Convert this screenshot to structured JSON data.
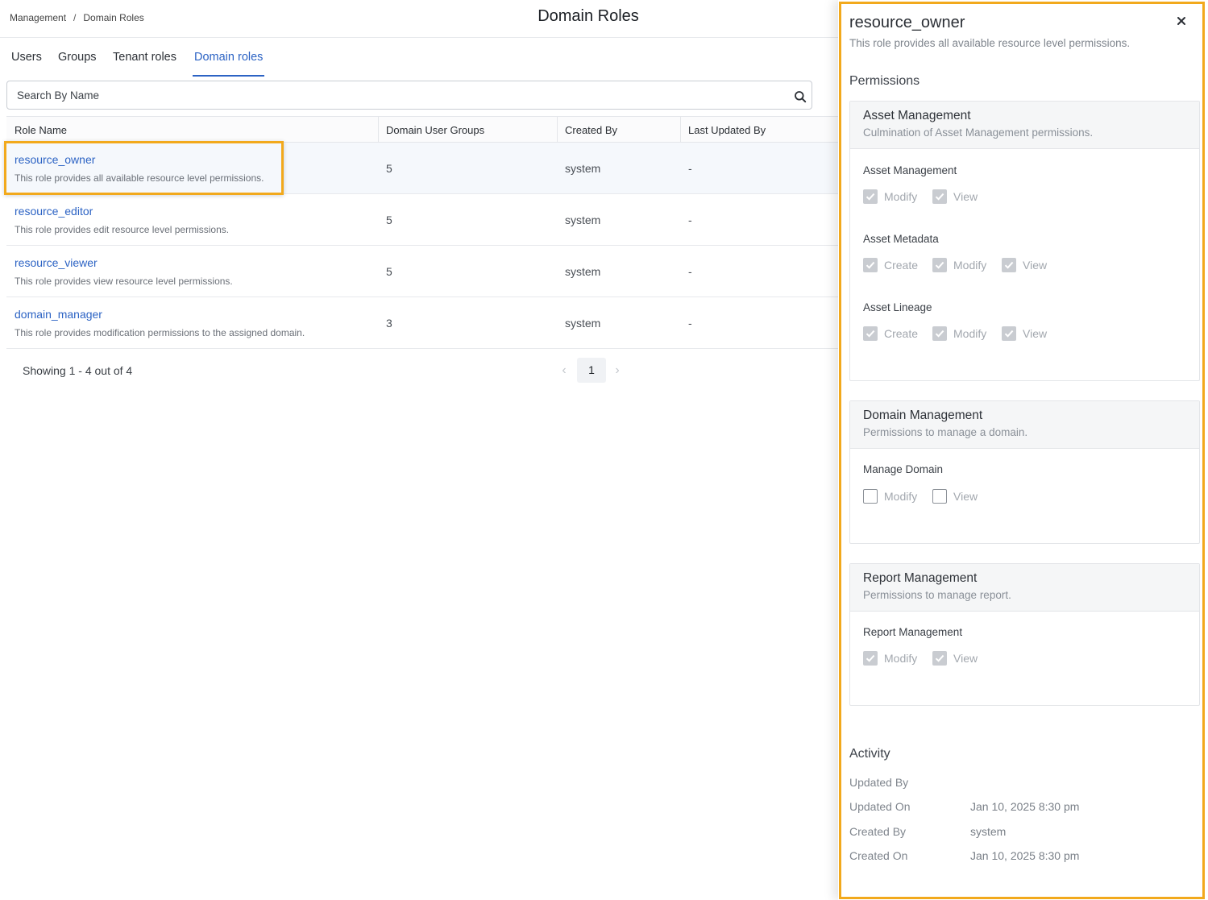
{
  "breadcrumb": {
    "parent": "Management",
    "separator": "/",
    "current": "Domain Roles"
  },
  "page_title": "Domain Roles",
  "tabs": [
    {
      "label": "Users",
      "active": false
    },
    {
      "label": "Groups",
      "active": false
    },
    {
      "label": "Tenant roles",
      "active": false
    },
    {
      "label": "Domain roles",
      "active": true
    }
  ],
  "search": {
    "placeholder": "Search By Name",
    "value": ""
  },
  "table": {
    "columns": [
      "Role Name",
      "Domain User Groups",
      "Created By",
      "Last Updated By"
    ],
    "rows": [
      {
        "name": "resource_owner",
        "description": "This role provides all available resource level permissions.",
        "groups": "5",
        "created_by": "system",
        "updated_by": "-"
      },
      {
        "name": "resource_editor",
        "description": "This role provides edit resource level permissions.",
        "groups": "5",
        "created_by": "system",
        "updated_by": "-"
      },
      {
        "name": "resource_viewer",
        "description": "This role provides view resource level permissions.",
        "groups": "5",
        "created_by": "system",
        "updated_by": "-"
      },
      {
        "name": "domain_manager",
        "description": "This role provides modification permissions to the assigned domain.",
        "groups": "3",
        "created_by": "system",
        "updated_by": "-"
      }
    ]
  },
  "pagination": {
    "showing": "Showing 1 - 4 out of 4",
    "prev": "‹",
    "page": "1",
    "next": "›"
  },
  "panel": {
    "title": "resource_owner",
    "description": "This role provides all available resource level permissions.",
    "close": "×",
    "permissions_label": "Permissions",
    "groups": [
      {
        "title": "Asset Management",
        "description": "Culmination of Asset Management permissions.",
        "permissions": [
          {
            "label": "Asset Management",
            "options": [
              {
                "label": "Modify",
                "checked": true
              },
              {
                "label": "View",
                "checked": true
              }
            ]
          },
          {
            "label": "Asset Metadata",
            "options": [
              {
                "label": "Create",
                "checked": true
              },
              {
                "label": "Modify",
                "checked": true
              },
              {
                "label": "View",
                "checked": true
              }
            ]
          },
          {
            "label": "Asset Lineage",
            "options": [
              {
                "label": "Create",
                "checked": true
              },
              {
                "label": "Modify",
                "checked": true
              },
              {
                "label": "View",
                "checked": true
              }
            ]
          }
        ]
      },
      {
        "title": "Domain Management",
        "description": "Permissions to manage a domain.",
        "permissions": [
          {
            "label": "Manage Domain",
            "options": [
              {
                "label": "Modify",
                "checked": false
              },
              {
                "label": "View",
                "checked": false
              }
            ]
          }
        ]
      },
      {
        "title": "Report Management",
        "description": "Permissions to manage report.",
        "permissions": [
          {
            "label": "Report Management",
            "options": [
              {
                "label": "Modify",
                "checked": true
              },
              {
                "label": "View",
                "checked": true
              }
            ]
          }
        ]
      }
    ],
    "activity_label": "Activity",
    "activity": [
      {
        "key": "Updated By",
        "value": ""
      },
      {
        "key": "Updated On",
        "value": "Jan 10, 2025 8:30 pm"
      },
      {
        "key": "Created By",
        "value": "system"
      },
      {
        "key": "Created On",
        "value": "Jan 10, 2025 8:30 pm"
      }
    ]
  },
  "colors": {
    "accent": "#2c63c4",
    "highlight": "#f2a91c",
    "checkbox_checked": "#c9ccd1"
  }
}
